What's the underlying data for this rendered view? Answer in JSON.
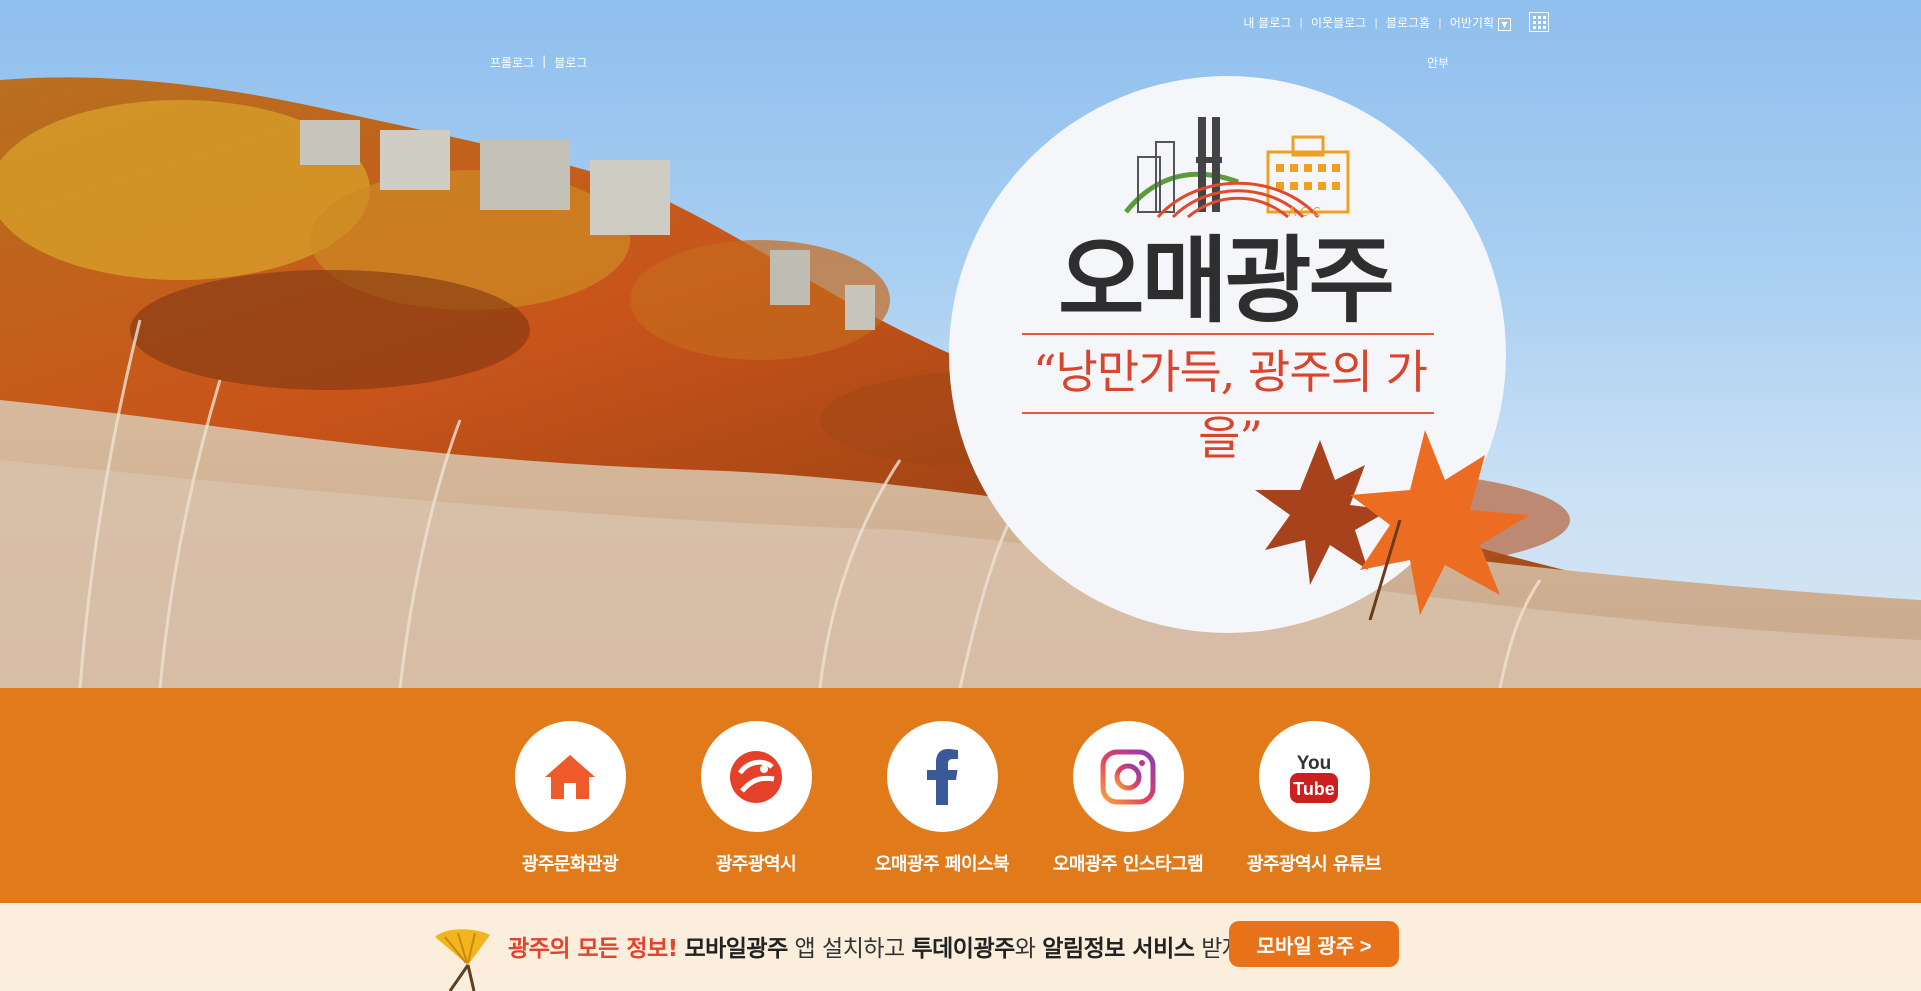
{
  "top_nav": {
    "my_blog": "내 블로그",
    "neighbor_blog": "이웃블로그",
    "blog_home": "블로그홈",
    "moderator": "어반기획"
  },
  "sub_nav": {
    "prologue": "프롤로그",
    "blog": "블로그",
    "annex": "안부"
  },
  "hero": {
    "logo_small_text": "A C C",
    "title": "오매광주",
    "slogan": "“낭만가득, 광주의 가을”"
  },
  "links": [
    {
      "label": "광주문화관광",
      "icon": "home-icon"
    },
    {
      "label": "광주광역시",
      "icon": "gwangju-symbol-icon"
    },
    {
      "label": "오매광주 페이스북",
      "icon": "facebook-icon"
    },
    {
      "label": "오매광주 인스타그램",
      "icon": "instagram-icon"
    },
    {
      "label": "광주광역시 유튜브",
      "icon": "youtube-icon"
    }
  ],
  "youtube_icon_text": {
    "you": "You",
    "tube": "Tube"
  },
  "strip": {
    "highlight": "광주의 모든 정보!",
    "app_name": "모바일광주",
    "middle": " 앱 설치하고 ",
    "service1": "투데이광주",
    "join": "와 ",
    "service2": "알림정보 서비스",
    "end": " 받자!!",
    "button": "모바일 광주 >"
  },
  "colors": {
    "band": "#e17a1a",
    "strip": "#fbeedd",
    "button": "#e8721a",
    "accent_red": "#e2432c"
  }
}
